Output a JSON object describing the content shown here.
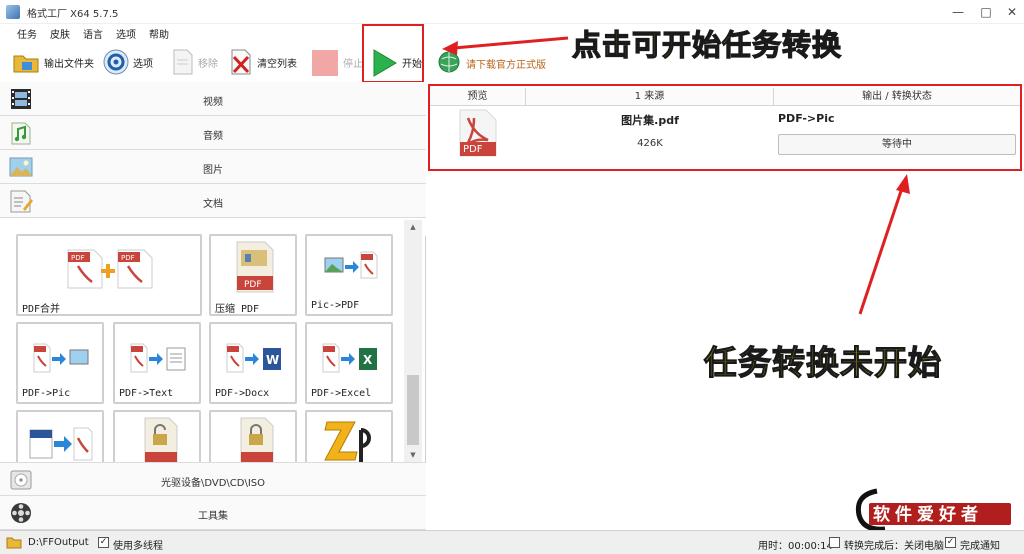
{
  "window": {
    "title": "格式工厂 X64 5.7.5",
    "minimize": "—",
    "maximize": "□",
    "close": "✕"
  },
  "menu": [
    "任务",
    "皮肤",
    "语言",
    "选项",
    "帮助"
  ],
  "toolbar": {
    "output_folder": "输出文件夹",
    "options": "选项",
    "remove": "移除",
    "clear_list": "清空列表",
    "stop": "停止",
    "start": "开始",
    "download_link": "请下载官方正式版"
  },
  "categories": {
    "video": "视频",
    "audio": "音频",
    "picture": "图片",
    "document": "文档",
    "disc": "光驱设备\\DVD\\CD\\ISO",
    "tools": "工具集"
  },
  "tools": [
    {
      "label": "PDF合并"
    },
    {
      "label": "压缩 PDF"
    },
    {
      "label": "Pic->PDF"
    },
    {
      "label": "PDF->Pic"
    },
    {
      "label": "PDF->Text"
    },
    {
      "label": "PDF->Docx"
    },
    {
      "label": "PDF->Excel"
    }
  ],
  "task_table": {
    "headers": [
      "预览",
      "1 来源",
      "输出 / 转换状态"
    ],
    "rows": [
      {
        "file_icon_text": "PDF",
        "file_name": "图片集.pdf",
        "file_size": "426K",
        "conversion": "PDF->Pic",
        "status": "等待中"
      }
    ]
  },
  "annotations": {
    "start_hint": "点击可开始任务转换",
    "status_hint": "任务转换未开始"
  },
  "statusbar": {
    "output_path": "D:\\FFOutput",
    "multithread": "使用多线程",
    "elapsed": "用时：00:00:14",
    "after_convert": "转换完成后：关闭电脑",
    "notify": "完成通知"
  },
  "watermark": {
    "text": "软件爱好者"
  },
  "colors": {
    "highlight_red": "#e02020",
    "annotation_yellow": "#ffe900",
    "start_green": "#2bb24c",
    "pdf_red": "#c9453c"
  }
}
